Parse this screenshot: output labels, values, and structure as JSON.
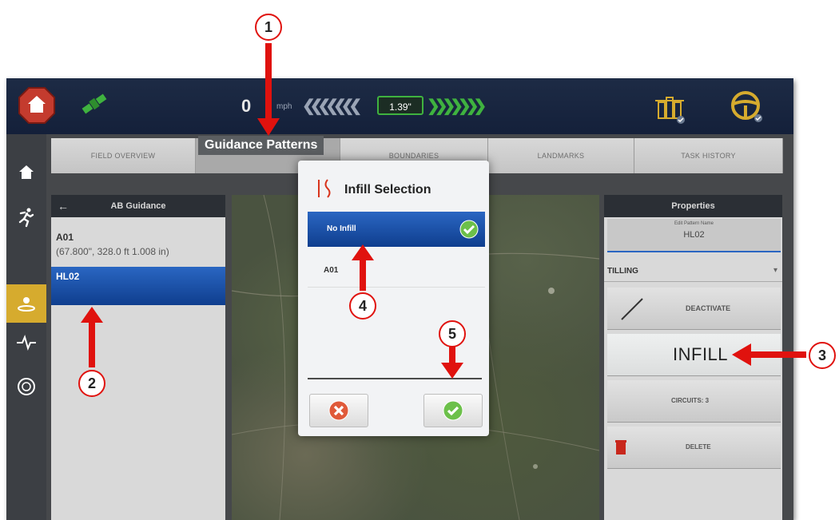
{
  "colors": {
    "accent_blue": "#1a4fa8",
    "callout_red": "#e0120e",
    "active_nav": "#d6ab2e",
    "ontrack_green": "#3fb23f"
  },
  "topbar": {
    "speed_value": "0",
    "speed_unit": "mph",
    "xte_value": "1.39\"",
    "icons": [
      "home-icon",
      "satellite-icon",
      "implement-icon",
      "steering-wheel-icon"
    ]
  },
  "nav": {
    "icons": [
      "home-icon",
      "runner-icon",
      "field-icon",
      "pulse-icon",
      "ut-icon"
    ],
    "active_index": 2
  },
  "tabs": [
    {
      "label": "FIELD OVERVIEW"
    },
    {
      "label": "Guidance Patterns"
    },
    {
      "label": "BOUNDARIES"
    },
    {
      "label": "LANDMARKS"
    },
    {
      "label": "TASK HISTORY"
    }
  ],
  "left_panel": {
    "title": "AB Guidance",
    "items": [
      {
        "name": "A01",
        "detail": "(67.800\", 328.0 ft 1.008 in)"
      },
      {
        "name": "HL02",
        "detail": ""
      }
    ]
  },
  "right_panel": {
    "title": "Properties",
    "pattern_name_label": "Edit Pattern Name",
    "pattern_name": "HL02",
    "operation": "TILLING",
    "deactivate_label": "DEACTIVATE",
    "infill_label": "INFILL",
    "circuits_label": "CIRCUITS: 3",
    "delete_label": "DELETE"
  },
  "dialog": {
    "title": "Infill Selection",
    "options": [
      {
        "label": "No Infill",
        "selected": true
      },
      {
        "label": "A01",
        "selected": false
      }
    ],
    "cancel_icon": "cancel-x-icon",
    "confirm_icon": "confirm-check-icon"
  },
  "callouts": [
    "1",
    "2",
    "3",
    "4",
    "5"
  ]
}
